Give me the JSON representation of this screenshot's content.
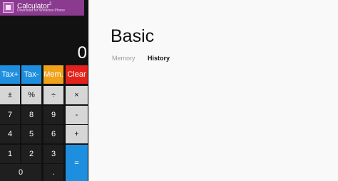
{
  "banner": {
    "app_name": "Calculator",
    "superscript": "2",
    "subtitle": "Download for Windows Phone"
  },
  "display": {
    "value": "0"
  },
  "keys": {
    "tax_plus": "Tax+",
    "tax_minus": "Tax-",
    "mem": "Mem.",
    "clear": "Clear",
    "plus_minus": "±",
    "percent": "%",
    "divide": "÷",
    "multiply": "×",
    "seven": "7",
    "eight": "8",
    "nine": "9",
    "minus": "-",
    "four": "4",
    "five": "5",
    "six": "6",
    "plus": "+",
    "one": "1",
    "two": "2",
    "three": "3",
    "equals": "=",
    "zero": "0",
    "dot": "."
  },
  "panel": {
    "title": "Basic",
    "tabs": [
      "Memory",
      "History"
    ]
  }
}
